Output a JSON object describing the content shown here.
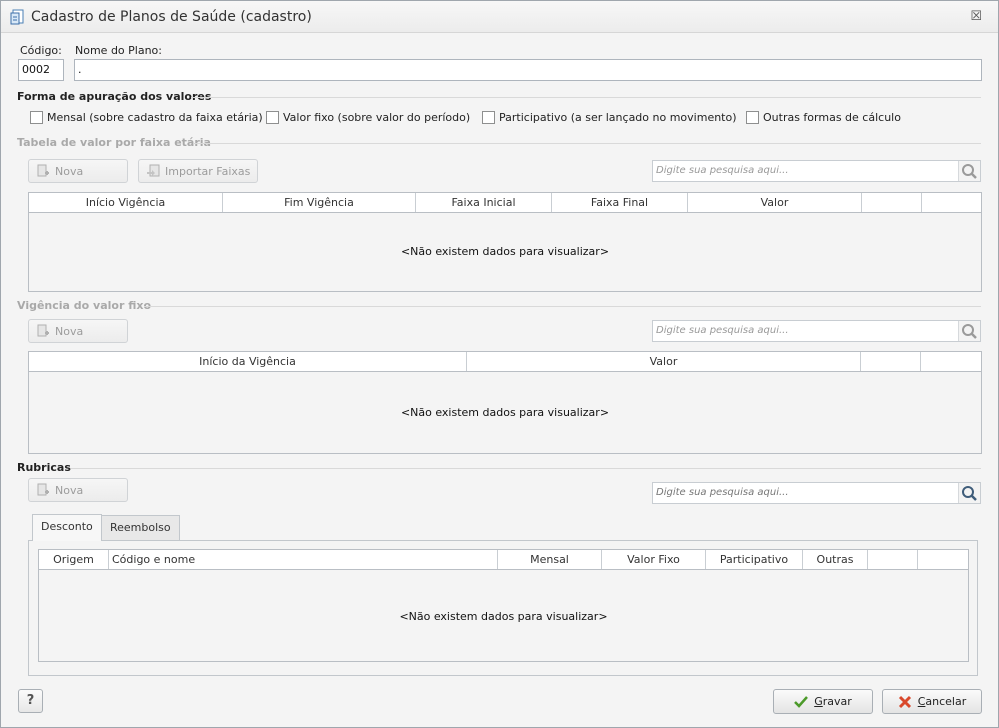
{
  "window": {
    "title": "Cadastro de Planos de Saúde (cadastro)",
    "close_glyph": "☒"
  },
  "header": {
    "codigo_label": "Código:",
    "codigo_value": "0002",
    "nome_label": "Nome do Plano:",
    "nome_value": "."
  },
  "forma": {
    "title": "Forma de apuração dos valores",
    "options": [
      "Mensal (sobre cadastro da faixa etária)",
      "Valor fixo (sobre valor do período)",
      "Participativo (a ser lançado no movimento)",
      "Outras formas de cálculo"
    ]
  },
  "faixa": {
    "title": "Tabela de valor por faixa etária",
    "new_label": "Nova",
    "import_label": "Importar Faixas",
    "search_placeholder": "Digite sua pesquisa aqui...",
    "columns": [
      "Início Vigência",
      "Fim Vigência",
      "Faixa Inicial",
      "Faixa Final",
      "Valor",
      "",
      ""
    ],
    "empty": "<Não existem dados para visualizar>"
  },
  "vigencia": {
    "title": "Vigência do valor fixo",
    "new_label": "Nova",
    "search_placeholder": "Digite sua pesquisa aqui...",
    "columns": [
      "Início da Vigência",
      "Valor",
      "",
      ""
    ],
    "empty": "<Não existem dados para visualizar>"
  },
  "rubricas": {
    "title": "Rubricas",
    "new_label": "Nova",
    "search_placeholder": "Digite sua pesquisa aqui...",
    "tabs": [
      "Desconto",
      "Reembolso"
    ],
    "columns": [
      "Origem",
      "Código e nome",
      "Mensal",
      "Valor Fixo",
      "Participativo",
      "Outras",
      "",
      ""
    ],
    "empty": "<Não existem dados para visualizar>"
  },
  "footer": {
    "help_glyph": "?",
    "save_prefix": "",
    "save_mnemonic": "G",
    "save_rest": "ravar",
    "cancel_mnemonic": "C",
    "cancel_rest": "ancelar"
  }
}
